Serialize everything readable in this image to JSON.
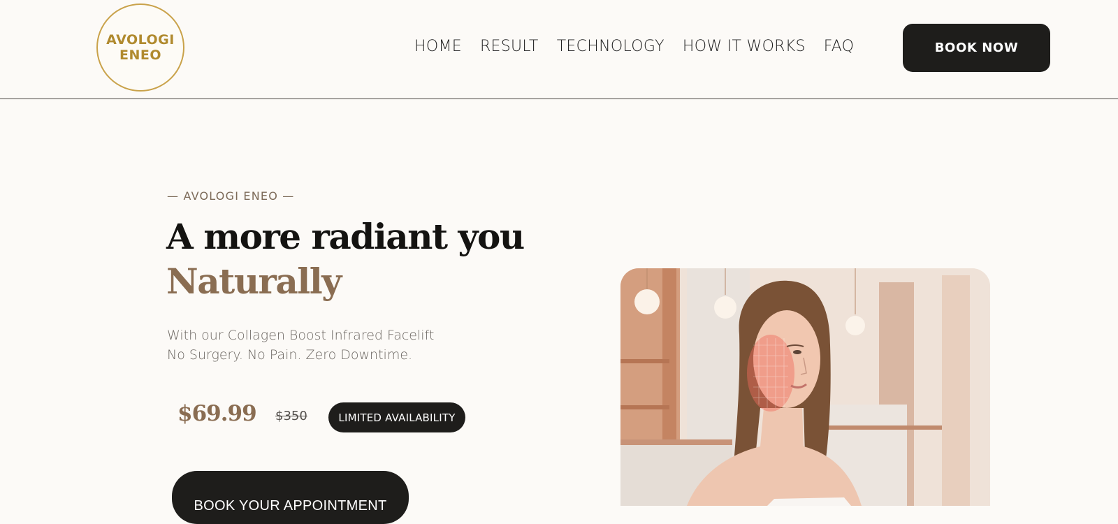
{
  "header": {
    "logo_line1": "AVOLOGI",
    "logo_line2": "ENEO",
    "nav": [
      "HOME",
      "RESULT",
      "TECHNOLOGY",
      "HOW IT WORKS",
      "FAQ"
    ],
    "book_now": "BOOK NOW"
  },
  "hero": {
    "eyebrow": "— AVOLOGI ENEO —",
    "title_line1": "A more radiant you",
    "title_line2": "Naturally",
    "subtitle_line1": "With our Collagen Boost Infrared Facelift",
    "subtitle_line2": "No Surgery. No Pain. Zero Downtime.",
    "price": "$69.99",
    "old_price": "$350",
    "badge": "LIMITED AVAILABILITY",
    "cta": "BOOK YOUR APPOINTMENT"
  },
  "colors": {
    "background": "#fcfaf7",
    "accent_brown": "#8a6d52",
    "dark_button": "#1e1d1b",
    "logo_gold": "#b08a2e"
  }
}
